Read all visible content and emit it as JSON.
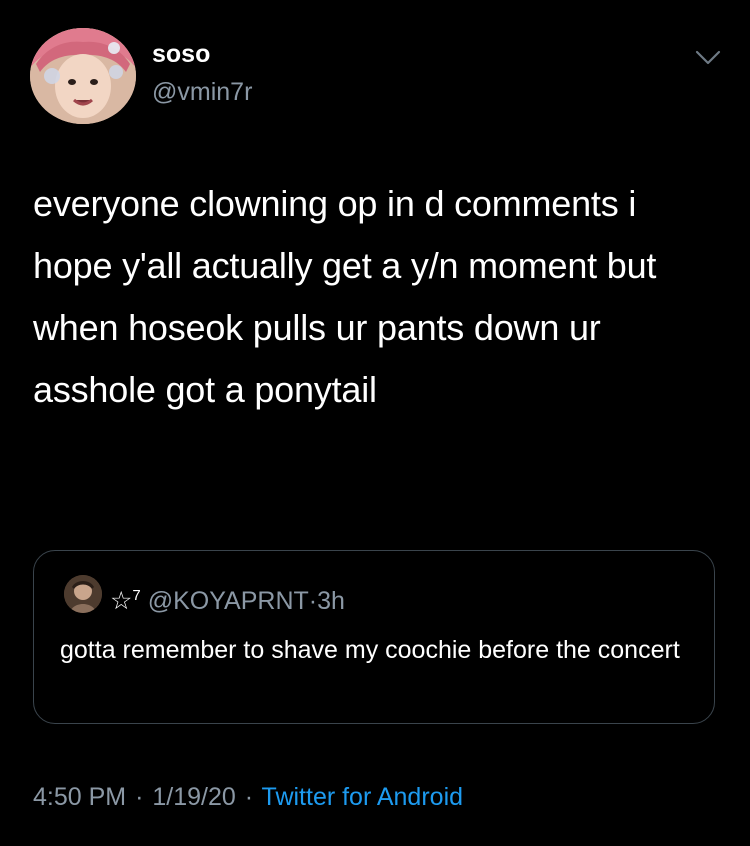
{
  "author": {
    "display_name": "soso",
    "handle": "@vmin7r"
  },
  "tweet": {
    "text": "everyone clowning op in d comments i hope y'all actually get a y/n moment but when hoseok pulls ur pants down ur asshole got a ponytail"
  },
  "quoted_tweet": {
    "display_name": "☆",
    "name_superscript": "7",
    "handle": "@KOYAPRNT",
    "separator": "·",
    "time": "3h",
    "text": "gotta remember to shave my coochie before the concert"
  },
  "meta": {
    "time": "4:50 PM",
    "separator": "·",
    "date": "1/19/20",
    "source": "Twitter for Android"
  },
  "icons": {
    "menu": "chevron-down-icon"
  },
  "colors": {
    "background": "#000000",
    "text": "#ffffff",
    "secondary": "#8b98a5",
    "link": "#1d9bf0",
    "border": "#3a444c"
  }
}
